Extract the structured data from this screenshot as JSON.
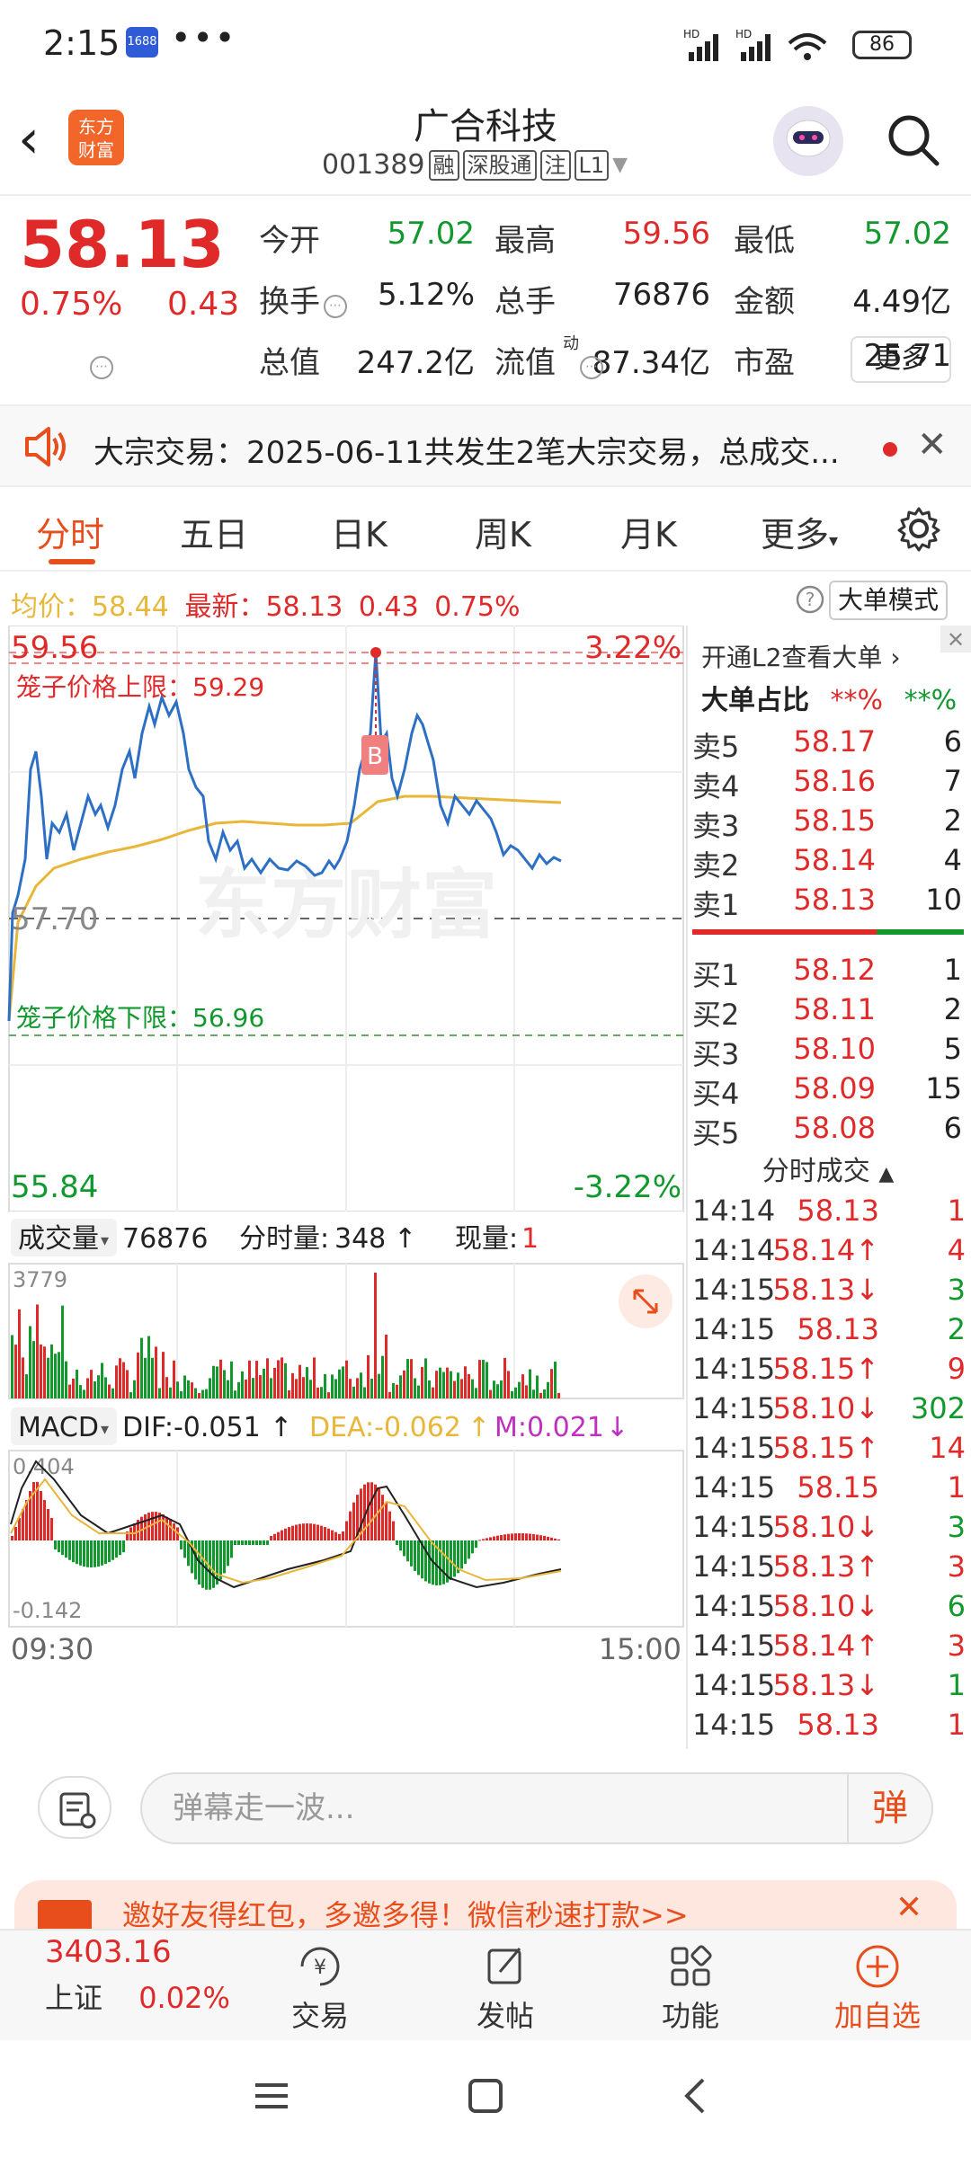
{
  "status_bar": {
    "time": "2:15",
    "app_badge": "1688",
    "more": "•••",
    "signals": "HD HD",
    "battery": "86"
  },
  "header": {
    "back": "‹",
    "logo_line1": "东方",
    "logo_line2": "财富",
    "title": "广合科技",
    "code": "001389",
    "tags": [
      "融",
      "深股通",
      "注",
      "L1"
    ]
  },
  "quote": {
    "price": "58.13",
    "change_pct": "0.75%",
    "change": "0.43",
    "fields": [
      {
        "label": "今开",
        "value": "57.02",
        "color": "#12992e"
      },
      {
        "label": "最高",
        "value": "59.56",
        "color": "#e02a2a"
      },
      {
        "label": "最低",
        "value": "57.02",
        "color": "#12992e"
      },
      {
        "label": "换手",
        "value": "5.12%",
        "color": "#222222"
      },
      {
        "label": "总手",
        "value": "76876",
        "color": "#222222"
      },
      {
        "label": "金额",
        "value": "4.49亿",
        "color": "#222222"
      },
      {
        "label": "总值",
        "value": "247.2亿",
        "color": "#222222"
      },
      {
        "label": "流值",
        "value": "87.34亿",
        "color": "#222222"
      },
      {
        "label": "市盈",
        "value": "25.71",
        "color": "#222222"
      }
    ],
    "pe_superscript": "动",
    "more_button": "更多"
  },
  "notice": {
    "text": "大宗交易：2025-06-11共发生2笔大宗交易，总成交...",
    "close": "✕"
  },
  "tabs": [
    "分时",
    "五日",
    "日K",
    "周K",
    "月K",
    "更多"
  ],
  "avg_bar": {
    "avg_label": "均价：",
    "avg_value": "58.44",
    "latest_label": "最新：",
    "latest_value": "58.13",
    "latest_change": "0.43",
    "latest_pct": "0.75%",
    "mode_button": "大单模式"
  },
  "chart": {
    "y_max": "59.56",
    "y_max_pct": "3.22%",
    "y_min": "55.84",
    "y_min_pct": "-3.22%",
    "prev_close": "57.70",
    "upper_limit": "笼子价格上限：59.29",
    "lower_limit": "笼子价格下限：56.96",
    "watermark": "东方财富",
    "marker": "B",
    "volume_label": "成交量",
    "volume_total": "76876",
    "tick_vol_label": "分时量:",
    "tick_vol_value": "348",
    "cur_vol_label": "现量:",
    "cur_vol_value": "1",
    "vol_max": "3779",
    "macd_label": "MACD",
    "dif": "DIF:-0.051",
    "dea": "DEA:-0.062",
    "m": "M:0.021",
    "macd_top": "0.404",
    "macd_bottom": "-0.142",
    "time_start": "09:30",
    "time_end": "15:00"
  },
  "order_book": {
    "l2_link": "开通L2查看大单",
    "big_ratio_label": "大单占比",
    "big_ratio_red": "**%",
    "big_ratio_green": "**%",
    "asks": [
      {
        "label": "卖5",
        "price": "58.17",
        "qty": "6"
      },
      {
        "label": "卖4",
        "price": "58.16",
        "qty": "7"
      },
      {
        "label": "卖3",
        "price": "58.15",
        "qty": "2"
      },
      {
        "label": "卖2",
        "price": "58.14",
        "qty": "4"
      },
      {
        "label": "卖1",
        "price": "58.13",
        "qty": "10"
      }
    ],
    "bids": [
      {
        "label": "买1",
        "price": "58.12",
        "qty": "1"
      },
      {
        "label": "买2",
        "price": "58.11",
        "qty": "2"
      },
      {
        "label": "买3",
        "price": "58.10",
        "qty": "5"
      },
      {
        "label": "买4",
        "price": "58.09",
        "qty": "15"
      },
      {
        "label": "买5",
        "price": "58.08",
        "qty": "6"
      }
    ],
    "trades_title": "分时成交",
    "trades": [
      {
        "time": "14:14",
        "price": "58.13",
        "qty": "1",
        "pc": "#e02a2a",
        "qc": "#e02a2a"
      },
      {
        "time": "14:14",
        "price": "58.14↑",
        "qty": "4",
        "pc": "#e02a2a",
        "qc": "#e02a2a"
      },
      {
        "time": "14:15",
        "price": "58.13↓",
        "qty": "3",
        "pc": "#e02a2a",
        "qc": "#12992e"
      },
      {
        "time": "14:15",
        "price": "58.13",
        "qty": "2",
        "pc": "#e02a2a",
        "qc": "#12992e"
      },
      {
        "time": "14:15",
        "price": "58.15↑",
        "qty": "9",
        "pc": "#e02a2a",
        "qc": "#e02a2a"
      },
      {
        "time": "14:15",
        "price": "58.10↓",
        "qty": "302",
        "pc": "#e02a2a",
        "qc": "#12992e"
      },
      {
        "time": "14:15",
        "price": "58.15↑",
        "qty": "14",
        "pc": "#e02a2a",
        "qc": "#e02a2a"
      },
      {
        "time": "14:15",
        "price": "58.15",
        "qty": "1",
        "pc": "#e02a2a",
        "qc": "#e02a2a"
      },
      {
        "time": "14:15",
        "price": "58.10↓",
        "qty": "3",
        "pc": "#e02a2a",
        "qc": "#12992e"
      },
      {
        "time": "14:15",
        "price": "58.13↑",
        "qty": "3",
        "pc": "#e02a2a",
        "qc": "#e02a2a"
      },
      {
        "time": "14:15",
        "price": "58.10↓",
        "qty": "6",
        "pc": "#e02a2a",
        "qc": "#12992e"
      },
      {
        "time": "14:15",
        "price": "58.14↑",
        "qty": "3",
        "pc": "#e02a2a",
        "qc": "#e02a2a"
      },
      {
        "time": "14:15",
        "price": "58.13↓",
        "qty": "1",
        "pc": "#e02a2a",
        "qc": "#12992e"
      },
      {
        "time": "14:15",
        "price": "58.13",
        "qty": "1",
        "pc": "#e02a2a",
        "qc": "#e02a2a"
      }
    ]
  },
  "comment": {
    "placeholder": "弹幕走一波...",
    "dan_button": "弹"
  },
  "promo": {
    "text": "邀好友得红包，多邀多得！微信秒速打款>>",
    "close": "✕"
  },
  "toolbar": {
    "index_value": "3403.16",
    "index_name": "上证",
    "index_pct": "0.02%",
    "items": [
      "交易",
      "发帖",
      "功能",
      "加自选"
    ]
  },
  "colors": {
    "up": "#e02a2a",
    "down": "#12992e",
    "accent": "#e84e1c",
    "price_line": "#2d6fc4",
    "avg_line": "#e8b73a"
  }
}
